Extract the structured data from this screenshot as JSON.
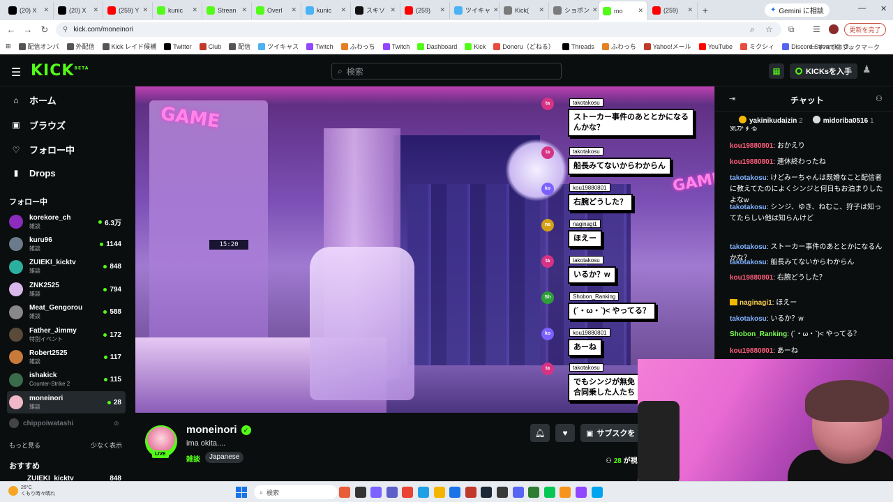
{
  "browser": {
    "tabs": [
      {
        "label": "(20) X",
        "color": "#000000"
      },
      {
        "label": "(20) X",
        "color": "#000000"
      },
      {
        "label": "(259) Y",
        "color": "#ff0000"
      },
      {
        "label": "kunic",
        "color": "#53fc18"
      },
      {
        "label": "Strean",
        "color": "#53fc18"
      },
      {
        "label": "Overl",
        "color": "#53fc18"
      },
      {
        "label": "kunic",
        "color": "#4ab3f4"
      },
      {
        "label": "スキソ",
        "color": "#111111"
      },
      {
        "label": "(259)",
        "color": "#ff0000"
      },
      {
        "label": "ツイキャ",
        "color": "#4ab3f4"
      },
      {
        "label": "Kick(",
        "color": "#7b7b7b"
      },
      {
        "label": "ショボン",
        "color": "#7b7b7b"
      },
      {
        "label": "mo",
        "color": "#53fc18"
      },
      {
        "label": "(259)",
        "color": "#ff0000"
      }
    ],
    "active_tab_index": 12,
    "new_tab": "+",
    "gemini_label": "Gemini に相談",
    "url": "kick.com/moneinori",
    "update_label": "更新を完了",
    "bookmarks": [
      {
        "label": "配信オンパ",
        "color": "#555"
      },
      {
        "label": "外配信",
        "color": "#555"
      },
      {
        "label": "Kick レイド候補",
        "color": "#555"
      },
      {
        "label": "Twitter",
        "color": "#000"
      },
      {
        "label": "Club",
        "color": "#c0392b"
      },
      {
        "label": "配信",
        "color": "#555"
      },
      {
        "label": "ツイキャス",
        "color": "#4ab3f4"
      },
      {
        "label": "Twitch",
        "color": "#9146ff"
      },
      {
        "label": "ふわっち",
        "color": "#e67e22"
      },
      {
        "label": "Twitch",
        "color": "#9146ff"
      },
      {
        "label": "Dashboard",
        "color": "#53fc18"
      },
      {
        "label": "Kick",
        "color": "#53fc18"
      },
      {
        "label": "Doneru（どねる）",
        "color": "#e74c3c"
      },
      {
        "label": "Threads",
        "color": "#000"
      },
      {
        "label": "ふわっち",
        "color": "#e67e22"
      },
      {
        "label": "Yahoo!メール",
        "color": "#c0392b"
      },
      {
        "label": "YouTube",
        "color": "#ff0000"
      },
      {
        "label": "ミクシィ",
        "color": "#e74c3c"
      },
      {
        "label": "Discord StreamKit O...",
        "color": "#5865f2"
      }
    ],
    "all_bookmarks": "すべてのブックマーク"
  },
  "kick": {
    "logo": "KICK",
    "logo_beta": "BETA",
    "search_placeholder": "検索",
    "kicks_label": "KICKsを入手",
    "nav": [
      {
        "label": "ホーム",
        "icon": "home-icon",
        "glyph": "⌂"
      },
      {
        "label": "ブラウズ",
        "icon": "browse-icon",
        "glyph": "▣"
      },
      {
        "label": "フォロー中",
        "icon": "heart-icon",
        "glyph": "♡"
      },
      {
        "label": "Drops",
        "icon": "drops-icon",
        "glyph": "▮"
      }
    ],
    "following_heading": "フォロー中",
    "following": [
      {
        "name": "korekore_ch",
        "category": "雑談",
        "viewers": "6.3万",
        "avatar": "#8c2cbe"
      },
      {
        "name": "kuru96",
        "category": "雑談",
        "viewers": "1144",
        "avatar": "#6b7b8c"
      },
      {
        "name": "ZUIEKI_kicktv",
        "category": "雑談",
        "viewers": "848",
        "avatar": "#2bb0a0"
      },
      {
        "name": "ZNK2525",
        "category": "雑談",
        "viewers": "794",
        "avatar": "#d8b8e8"
      },
      {
        "name": "Meat_Gengorou",
        "category": "雑談",
        "viewers": "588",
        "avatar": "#888"
      },
      {
        "name": "Father_Jimmy",
        "category": "特別イベント",
        "viewers": "172",
        "avatar": "#5a4a3a"
      },
      {
        "name": "Robert2525",
        "category": "雑談",
        "viewers": "117",
        "avatar": "#c87a3a"
      },
      {
        "name": "ishakick",
        "category": "Counter-Strike 2",
        "viewers": "115",
        "avatar": "#3a6b4a"
      },
      {
        "name": "moneinori",
        "category": "雑談",
        "viewers": "28",
        "avatar": "#f0b8c8"
      }
    ],
    "offline_channel": "chippoiwatashi",
    "show_more": "もっと見る",
    "show_less": "少なく表示",
    "recommended_heading": "おすすめ",
    "recommended_first": "ZUIEKI_kicktv",
    "recommended_first_viewers": "848"
  },
  "video": {
    "clock": "15:20",
    "wall_text_left": "GAME",
    "wall_text_right": "GAME",
    "overlay_messages": [
      {
        "short": "ta",
        "user": "takotakosu",
        "text": "ストーカー事件のあととかになる\nんかな？",
        "color": "#d63384"
      },
      {
        "short": "ta",
        "user": "takotakosu",
        "text": "船長みてないからわからん",
        "color": "#d63384"
      },
      {
        "short": "ko",
        "user": "kou19880801",
        "text": "右腕どうした？",
        "color": "#7b61ff"
      },
      {
        "short": "na",
        "user": "naginagi1",
        "text": "ほえー",
        "color": "#d4a017"
      },
      {
        "short": "ta",
        "user": "takotakosu",
        "text": "いるか？w",
        "color": "#d63384"
      },
      {
        "short": "Sh",
        "user": "Shobon_Ranking",
        "text": "(´・ω・`)< やってる？",
        "color": "#2e9e3a"
      },
      {
        "short": "ko",
        "user": "kou19880801",
        "text": "あーね",
        "color": "#7b61ff"
      },
      {
        "short": "ta",
        "user": "takotakosu",
        "text": "でもシンジが無免\n合同乗した人たち",
        "color": "#d63384"
      }
    ]
  },
  "stream": {
    "name": "moneinori",
    "title": "ima okita....",
    "category": "雑談",
    "language": "Japanese",
    "live": "LIVE",
    "subscribe": "サブスクを",
    "viewers_count": "28",
    "viewers_suffix": "が視"
  },
  "chat": {
    "title": "チャット",
    "pinned": [
      {
        "name": "yakinikudaizin",
        "count": "2"
      },
      {
        "name": "midoriba0516",
        "count": "1"
      }
    ],
    "partial_top": "気がする",
    "messages": [
      {
        "user": "kou19880801",
        "text": "おかえり",
        "color": "red",
        "badge": false
      },
      {
        "user": "kou19880801",
        "text": "連休終わったね",
        "color": "red",
        "badge": false
      },
      {
        "user": "takotakosu",
        "text": "けどみーちゃんは既婚なこと配信者に教えてたのによくシンジと何日もお泊まりしたよなw",
        "color": "blue",
        "badge": false
      },
      {
        "user": "takotakosu",
        "text": "シンジ、ゆき、ねむこ、狩子は知ってたらしい他は知らんけど",
        "color": "blue",
        "badge": false
      },
      {
        "user": "takotakosu",
        "text": "ストーカー事件のあととかになるんかな？",
        "color": "blue",
        "badge": false
      },
      {
        "user": "takotakosu",
        "text": "船長みてないからわからん",
        "color": "blue",
        "badge": false
      },
      {
        "user": "kou19880801",
        "text": "右腕どうした？",
        "color": "red",
        "badge": false
      },
      {
        "user": "naginagi1",
        "text": "ほえー",
        "color": "yel",
        "badge": true
      },
      {
        "user": "takotakosu",
        "text": "いるか？w",
        "color": "blue",
        "badge": false
      },
      {
        "user": "Shobon_Ranking",
        "text": "(´・ω・`)< やってる？",
        "color": "grn",
        "badge": false
      },
      {
        "user": "kou19880801",
        "text": "あーね",
        "color": "red",
        "badge": false
      }
    ]
  },
  "taskbar": {
    "temp": "26°C",
    "weather": "くもり時々晴れ",
    "search": "検索"
  }
}
